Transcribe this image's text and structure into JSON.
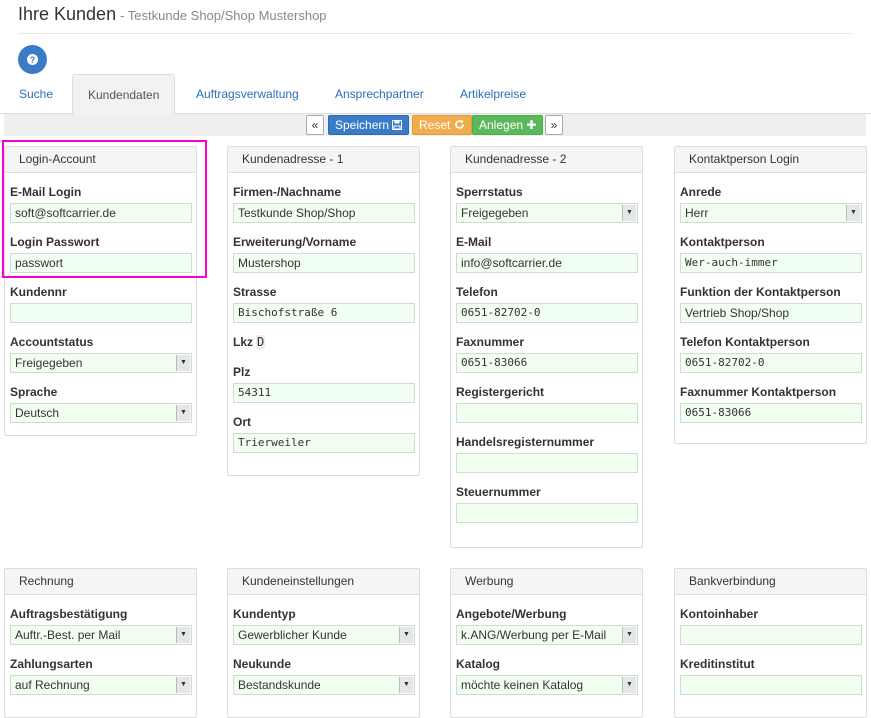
{
  "header": {
    "title": "Ihre Kunden",
    "subtitle": "- Testkunde Shop/Shop Mustershop"
  },
  "tabs": [
    {
      "label": "Suche"
    },
    {
      "label": "Kundendaten"
    },
    {
      "label": "Auftragsverwaltung"
    },
    {
      "label": "Ansprechpartner"
    },
    {
      "label": "Artikelpreise"
    }
  ],
  "toolbar": {
    "prev": "«",
    "save_label": "Speichern",
    "reset_label": "Reset",
    "add_label": "Anlegen",
    "next": "»"
  },
  "panels": {
    "login": {
      "title": "Login-Account",
      "fields": [
        {
          "label": "E-Mail Login",
          "value": "soft@softcarrier.de"
        },
        {
          "label": "Login Passwort",
          "value": "passwort"
        },
        {
          "label": "Kundennr",
          "value": ""
        },
        {
          "label": "Accountstatus",
          "value": "Freigegeben"
        },
        {
          "label": "Sprache",
          "value": "Deutsch"
        }
      ]
    },
    "address1": {
      "title": "Kundenadresse - 1",
      "fields": [
        {
          "label": "Firmen-/Nachname",
          "value": "Testkunde Shop/Shop"
        },
        {
          "label": "Erweiterung/Vorname",
          "value": "Mustershop"
        },
        {
          "label": "Strasse",
          "value": "Bischofstraße 6"
        },
        {
          "label": "Lkz",
          "value": "D"
        },
        {
          "label": "Plz",
          "value": "54311"
        },
        {
          "label": "Ort",
          "value": "Trierweiler"
        }
      ]
    },
    "address2": {
      "title": "Kundenadresse - 2",
      "fields": [
        {
          "label": "Sperrstatus",
          "value": "Freigegeben"
        },
        {
          "label": "E-Mail",
          "value": "info@softcarrier.de"
        },
        {
          "label": "Telefon",
          "value": "0651-82702-0"
        },
        {
          "label": "Faxnummer",
          "value": "0651-83066"
        },
        {
          "label": "Registergericht",
          "value": ""
        },
        {
          "label": "Handelsregisternummer",
          "value": ""
        },
        {
          "label": "Steuernummer",
          "value": ""
        }
      ]
    },
    "contact": {
      "title": "Kontaktperson Login",
      "fields": [
        {
          "label": "Anrede",
          "value": "Herr"
        },
        {
          "label": "Kontaktperson",
          "value": "Wer-auch-immer"
        },
        {
          "label": "Funktion der Kontaktperson",
          "value": "Vertrieb Shop/Shop"
        },
        {
          "label": "Telefon Kontaktperson",
          "value": "0651-82702-0"
        },
        {
          "label": "Faxnummer Kontaktperson",
          "value": "0651-83066"
        }
      ]
    },
    "invoice": {
      "title": "Rechnung",
      "fields": [
        {
          "label": "Auftragsbestätigung",
          "value": "Auftr.-Best. per Mail"
        },
        {
          "label": "Zahlungsarten",
          "value": "auf Rechnung"
        }
      ]
    },
    "settings": {
      "title": "Kundeneinstellungen",
      "fields": [
        {
          "label": "Kundentyp",
          "value": "Gewerblicher Kunde"
        },
        {
          "label": "Neukunde",
          "value": "Bestandskunde"
        }
      ]
    },
    "advert": {
      "title": "Werbung",
      "fields": [
        {
          "label": "Angebote/Werbung",
          "value": "k.ANG/Werbung per E-Mail"
        },
        {
          "label": "Katalog",
          "value": "möchte keinen Katalog"
        }
      ]
    },
    "bank": {
      "title": "Bankverbindung",
      "fields": [
        {
          "label": "Kontoinhaber",
          "value": ""
        },
        {
          "label": "Kreditinstitut",
          "value": ""
        }
      ]
    }
  },
  "colors": {
    "accent": "#3a7bc8",
    "warning": "#f0ad4e",
    "success": "#5cb85c",
    "highlight": "#ff00cc",
    "input_bg": "#f0fff0"
  }
}
